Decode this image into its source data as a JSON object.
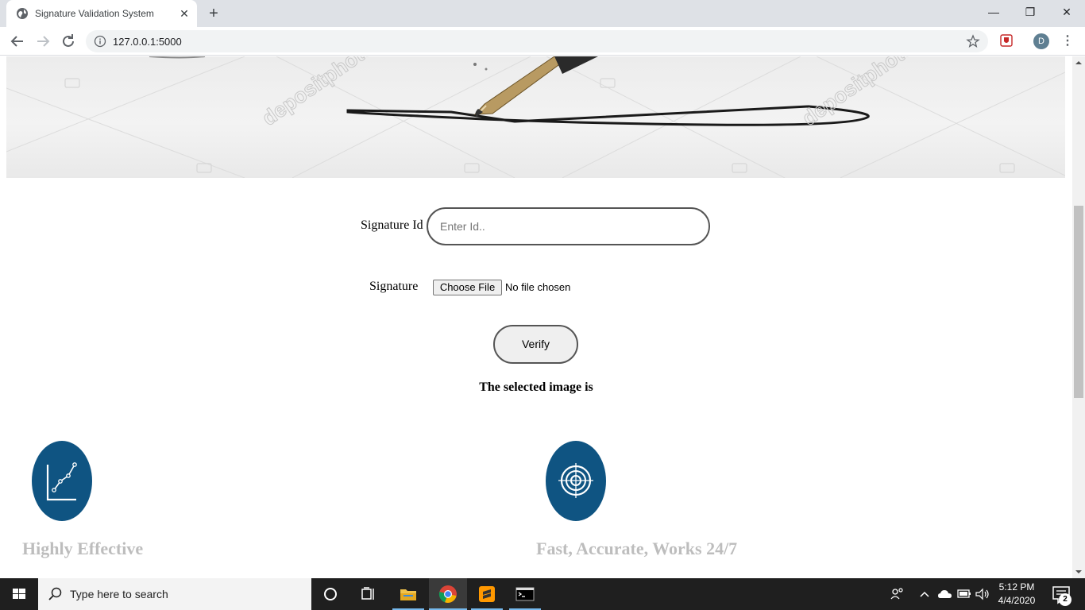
{
  "browser": {
    "tab_title": "Signature Validation System",
    "tab_close": "✕",
    "new_tab": "+",
    "url": "127.0.0.1:5000",
    "profile_initial": "D",
    "window": {
      "minimize": "—",
      "maximize": "❐",
      "close": "✕"
    },
    "menu": "⋮"
  },
  "hero": {
    "watermark": "depositphotos"
  },
  "form": {
    "id_label": "Signature Id",
    "id_placeholder": "Enter Id..",
    "signature_label": "Signature",
    "file_button": "Choose File",
    "file_status": "No file chosen",
    "verify_button": "Verify",
    "result_text": "The selected image is"
  },
  "features": [
    {
      "title": "Highly Effective",
      "icon": "line-chart-icon"
    },
    {
      "title": "Fast, Accurate, Works 24/7",
      "icon": "target-icon"
    }
  ],
  "taskbar": {
    "search_placeholder": "Type here to search",
    "time": "5:12 PM",
    "date": "4/4/2020",
    "notification_count": "2",
    "apps": [
      "cortana-icon",
      "task-view-icon",
      "file-explorer-icon",
      "chrome-icon",
      "sublime-text-icon",
      "terminal-icon"
    ]
  },
  "colors": {
    "feature_circle": "#0f5482",
    "feature_title": "#bdbdbd",
    "tab_strip": "#dee1e6",
    "taskbar": "#1f1f1f"
  }
}
